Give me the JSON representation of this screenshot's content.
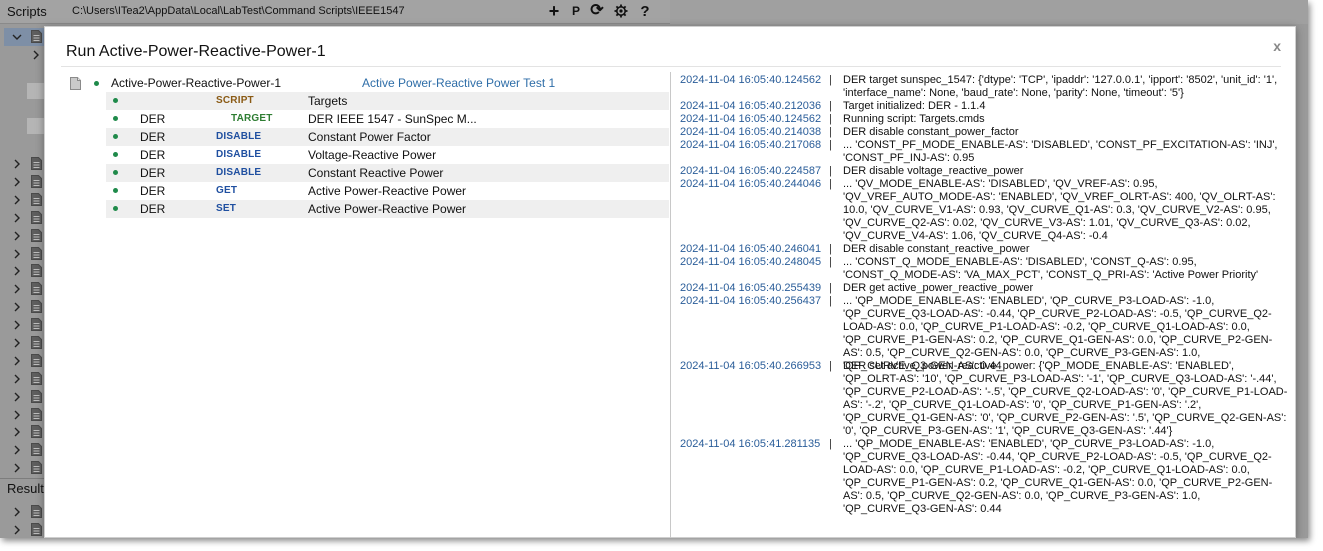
{
  "topbar": {
    "title": "Scripts",
    "path": "C:\\Users\\ITea2\\AppData\\Local\\LabTest\\Command Scripts\\IEEE1547",
    "add_label": "+",
    "p_label": "P",
    "refresh_label": "⟳",
    "help_label": "?"
  },
  "sidebar": {
    "results_label": "Results"
  },
  "dialog": {
    "title": "Run Active-Power-Reactive-Power-1",
    "close_label": "x",
    "root": {
      "name": "Active-Power-Reactive-Power-1",
      "description": "Active Power-Reactive Power Test 1"
    },
    "steps": [
      {
        "target": "",
        "action": "SCRIPT",
        "action_color": "#8a5a14",
        "name": "Targets"
      },
      {
        "target": "DER",
        "action": "TARGET",
        "action_color": "#2e7d32",
        "name": "DER IEEE 1547 - SunSpec M..."
      },
      {
        "target": "DER",
        "action": "DISABLE",
        "action_color": "#1f4fa0",
        "name": "Constant Power Factor"
      },
      {
        "target": "DER",
        "action": "DISABLE",
        "action_color": "#1f4fa0",
        "name": "Voltage-Reactive Power"
      },
      {
        "target": "DER",
        "action": "DISABLE",
        "action_color": "#1f4fa0",
        "name": "Constant Reactive Power"
      },
      {
        "target": "DER",
        "action": "GET",
        "action_color": "#1f4fa0",
        "name": "Active Power-Reactive Power"
      },
      {
        "target": "DER",
        "action": "SET",
        "action_color": "#1f4fa0",
        "name": "Active Power-Reactive Power"
      }
    ],
    "log_separator": "|",
    "log": [
      {
        "ts": "2024-11-04 16:05:40.124562",
        "msg": "DER target sunspec_1547: {'dtype': 'TCP', 'ipaddr': '127.0.0.1', 'ipport': '8502', 'unit_id': '1', 'interface_name': None, 'baud_rate': None, 'parity': None, 'timeout': '5'}"
      },
      {
        "ts": "2024-11-04 16:05:40.212036",
        "msg": "Target initialized: DER - 1.1.4"
      },
      {
        "ts": "2024-11-04 16:05:40.124562",
        "msg": "Running script: Targets.cmds"
      },
      {
        "ts": "2024-11-04 16:05:40.214038",
        "msg": "DER disable constant_power_factor"
      },
      {
        "ts": "2024-11-04 16:05:40.217068",
        "msg": "... 'CONST_PF_MODE_ENABLE-AS': 'DISABLED', 'CONST_PF_EXCITATION-AS': 'INJ', 'CONST_PF_INJ-AS': 0.95"
      },
      {
        "ts": "2024-11-04 16:05:40.224587",
        "msg": "DER disable voltage_reactive_power"
      },
      {
        "ts": "2024-11-04 16:05:40.244046",
        "msg": "... 'QV_MODE_ENABLE-AS': 'DISABLED', 'QV_VREF-AS': 0.95, 'QV_VREF_AUTO_MODE-AS': 'ENABLED', 'QV_VREF_OLRT-AS': 400, 'QV_OLRT-AS': 10.0, 'QV_CURVE_V1-AS': 0.93, 'QV_CURVE_Q1-AS': 0.3, 'QV_CURVE_V2-AS': 0.95, 'QV_CURVE_Q2-AS': 0.02, 'QV_CURVE_V3-AS': 1.01, 'QV_CURVE_Q3-AS': 0.02, 'QV_CURVE_V4-AS': 1.06, 'QV_CURVE_Q4-AS': -0.4"
      },
      {
        "ts": "2024-11-04 16:05:40.246041",
        "msg": "DER disable constant_reactive_power"
      },
      {
        "ts": "2024-11-04 16:05:40.248045",
        "msg": "... 'CONST_Q_MODE_ENABLE-AS': 'DISABLED', 'CONST_Q-AS': 0.95, 'CONST_Q_MODE-AS': 'VA_MAX_PCT', 'CONST_Q_PRI-AS': 'Active Power Priority'"
      },
      {
        "ts": "2024-11-04 16:05:40.255439",
        "msg": "DER get active_power_reactive_power"
      },
      {
        "ts": "2024-11-04 16:05:40.256437",
        "msg": "... 'QP_MODE_ENABLE-AS': 'ENABLED', 'QP_CURVE_P3-LOAD-AS': -1.0, 'QP_CURVE_Q3-LOAD-AS': -0.44, 'QP_CURVE_P2-LOAD-AS': -0.5, 'QP_CURVE_Q2-LOAD-AS': 0.0, 'QP_CURVE_P1-LOAD-AS': -0.2, 'QP_CURVE_Q1-LOAD-AS': 0.0, 'QP_CURVE_P1-GEN-AS': 0.2, 'QP_CURVE_Q1-GEN-AS': 0.0, 'QP_CURVE_P2-GEN-AS': 0.5, 'QP_CURVE_Q2-GEN-AS': 0.0, 'QP_CURVE_P3-GEN-AS': 1.0, 'QP_CURVE_Q3-GEN-AS': 0.44"
      },
      {
        "ts": "2024-11-04 16:05:40.266953",
        "msg": "DER set active_power_reactive_power: {'QP_MODE_ENABLE-AS': 'ENABLED', 'QP_OLRT-AS': '10', 'QP_CURVE_P3-LOAD-AS': '-1', 'QP_CURVE_Q3-LOAD-AS': '-.44', 'QP_CURVE_P2-LOAD-AS': '-.5', 'QP_CURVE_Q2-LOAD-AS': '0', 'QP_CURVE_P1-LOAD-AS': '-.2', 'QP_CURVE_Q1-LOAD-AS': '0', 'QP_CURVE_P1-GEN-AS': '.2', 'QP_CURVE_Q1-GEN-AS': '0', 'QP_CURVE_P2-GEN-AS': '.5', 'QP_CURVE_Q2-GEN-AS': '0', 'QP_CURVE_P3-GEN-AS': '1', 'QP_CURVE_Q3-GEN-AS': '.44'}"
      },
      {
        "ts": "2024-11-04 16:05:41.281135",
        "msg": "... 'QP_MODE_ENABLE-AS': 'ENABLED', 'QP_CURVE_P3-LOAD-AS': -1.0, 'QP_CURVE_Q3-LOAD-AS': -0.44, 'QP_CURVE_P2-LOAD-AS': -0.5, 'QP_CURVE_Q2-LOAD-AS': 0.0, 'QP_CURVE_P1-LOAD-AS': -0.2, 'QP_CURVE_Q1-LOAD-AS': 0.0, 'QP_CURVE_P1-GEN-AS': 0.2, 'QP_CURVE_Q1-GEN-AS': 0.0, 'QP_CURVE_P2-GEN-AS': 0.5, 'QP_CURVE_Q2-GEN-AS': 0.0, 'QP_CURVE_P3-GEN-AS': 1.0, 'QP_CURVE_Q3-GEN-AS': 0.44"
      }
    ]
  }
}
